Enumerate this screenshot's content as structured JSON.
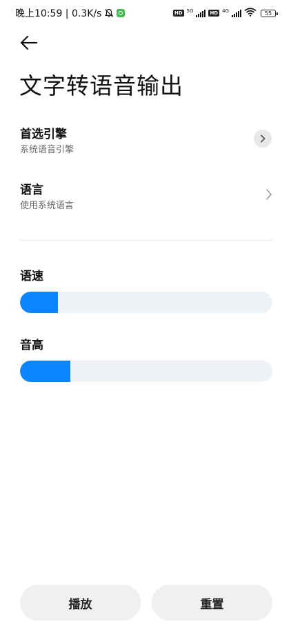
{
  "status_bar": {
    "time_speed": "晚上10:59 | 0.3K/s",
    "hd1": "HD",
    "gen1": "5G",
    "hd2": "HD",
    "gen2": "4G",
    "battery": "55"
  },
  "page": {
    "title": "文字转语音输出"
  },
  "settings": {
    "engine": {
      "title": "首选引擎",
      "subtitle": "系统语音引擎"
    },
    "language": {
      "title": "语言",
      "subtitle": "使用系统语言"
    }
  },
  "sliders": {
    "speech_rate": {
      "label": "语速",
      "value_fraction": 0.15
    },
    "pitch": {
      "label": "音高",
      "value_fraction": 0.2
    }
  },
  "buttons": {
    "play": "播放",
    "reset": "重置"
  },
  "colors": {
    "accent": "#0d84ff",
    "track": "#eef1f5",
    "button_bg": "#f0f0f2"
  },
  "icons": {
    "back": "arrow-left-icon",
    "engine_chevron": "chevron-right-circle-icon",
    "language_chevron": "chevron-right-icon",
    "mute": "bell-off-icon",
    "wifi": "wifi-icon"
  }
}
